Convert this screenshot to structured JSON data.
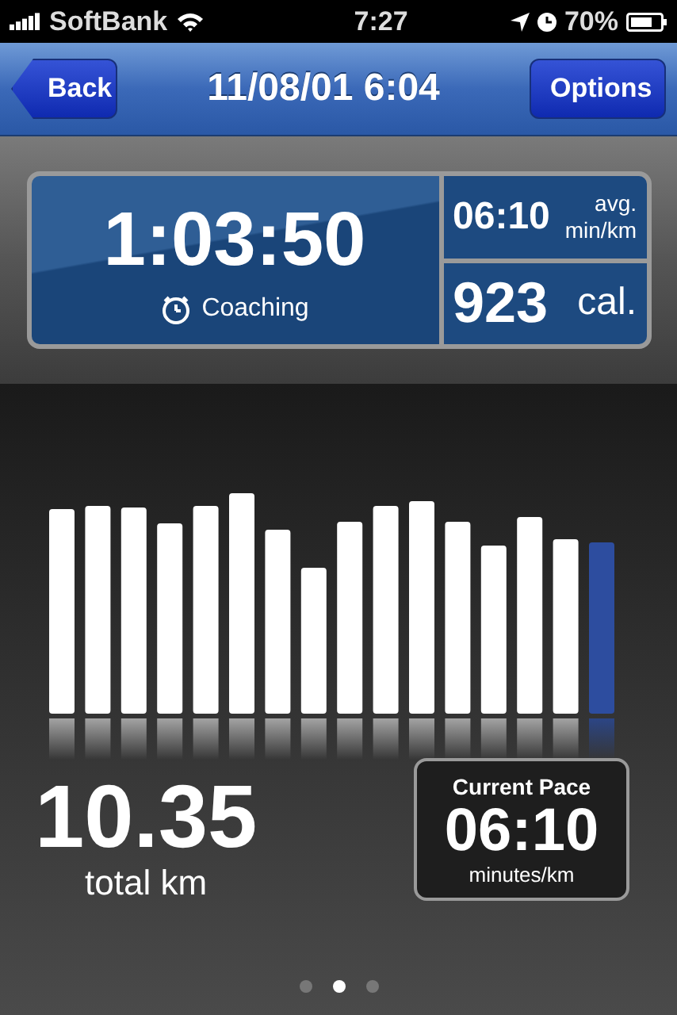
{
  "status_bar": {
    "carrier": "SoftBank",
    "time": "7:27",
    "battery": "70%"
  },
  "nav": {
    "back": "Back",
    "title": "11/08/01 6:04",
    "options": "Options"
  },
  "summary": {
    "duration": "1:03:50",
    "coaching": "Coaching",
    "pace": "06:10",
    "pace_unit_1": "avg.",
    "pace_unit_2": "min/km",
    "calories": "923",
    "calories_unit": "cal."
  },
  "distance": {
    "value": "10.35",
    "unit": "total km"
  },
  "current_pace": {
    "title": "Current Pace",
    "value": "06:10",
    "unit": "minutes/km"
  },
  "pages": [
    {
      "selected": false
    },
    {
      "selected": true
    },
    {
      "selected": false
    }
  ]
}
